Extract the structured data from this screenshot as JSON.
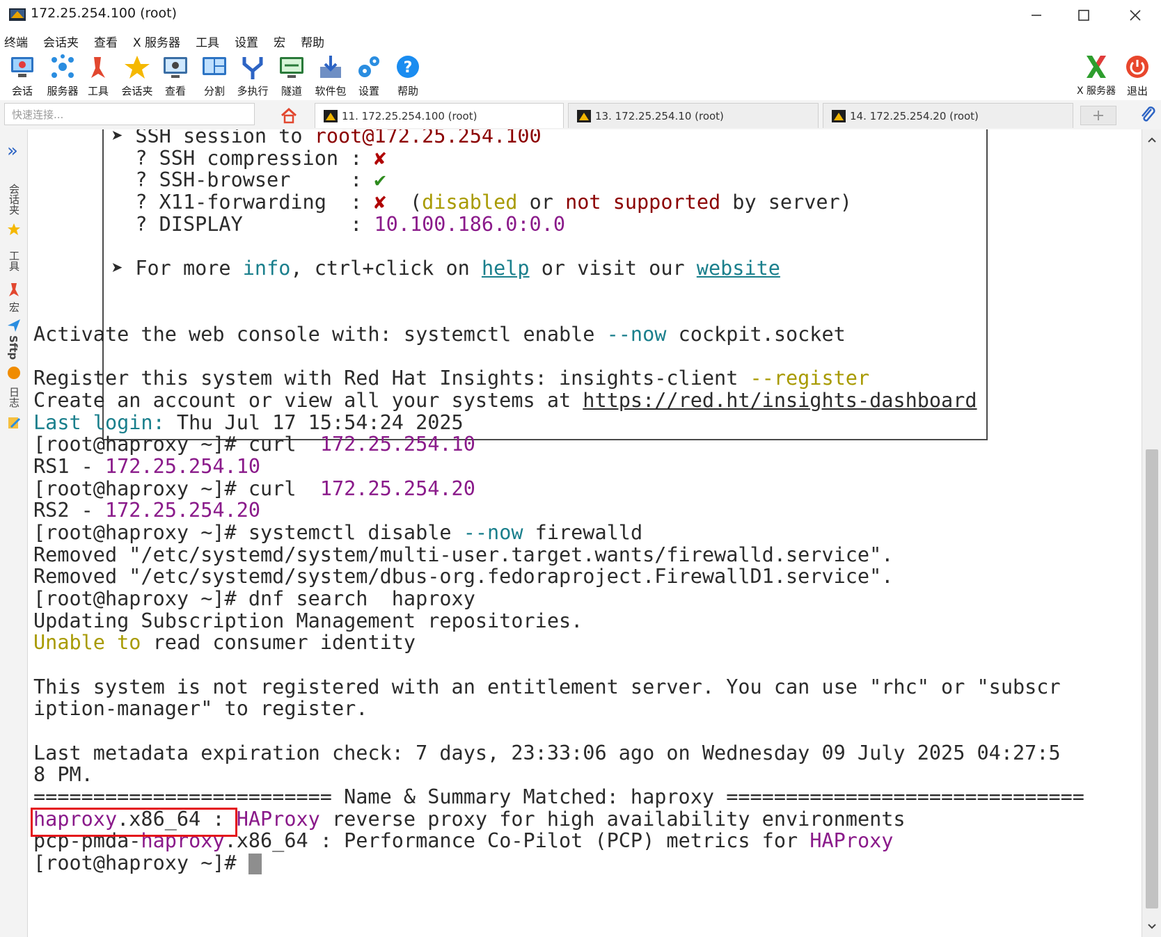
{
  "window": {
    "title": "172.25.254.100 (root)",
    "minimize": "—",
    "maximize": "☐",
    "close": "✕"
  },
  "menu": [
    "终端",
    "会话夹",
    "查看",
    "X 服务器",
    "工具",
    "设置",
    "宏",
    "帮助"
  ],
  "toolbar": {
    "items": [
      "会话",
      "服务器",
      "工具",
      "会话夹",
      "查看",
      "分割",
      "多执行",
      "隧道",
      "软件包",
      "设置",
      "帮助"
    ],
    "xserver": "X 服务器",
    "exit": "退出"
  },
  "quick_connect": {
    "placeholder": "快速连接..."
  },
  "tabs": [
    {
      "label": "11. 172.25.254.100 (root)"
    },
    {
      "label": "13. 172.25.254.10 (root)"
    },
    {
      "label": "14. 172.25.254.20 (root)"
    }
  ],
  "sidebar": {
    "expand": "»",
    "sessions": "会话夹",
    "tools": "工具",
    "macros": "宏",
    "sftp": "Sftp",
    "log": "日志"
  },
  "terminal": {
    "box": {
      "l1_a": "➤ SSH session to ",
      "l1_b": "root@172.25.254.100",
      "l2_a": "  ? SSH compression : ",
      "l2_b": "✘",
      "l3_a": "  ? SSH-browser     : ",
      "l3_b": "✔",
      "l4_a": "  ? X11-forwarding  : ",
      "l4_b": "✘",
      "l4_c": "  (",
      "l4_d": "disabled",
      "l4_e": " or ",
      "l4_f": "not supported",
      "l4_g": " by server)",
      "l5_a": "  ? DISPLAY         : ",
      "l5_b": "10.100.186.0:0.0",
      "l6_a": "➤ For more ",
      "l6_b": "info",
      "l6_c": ", ctrl+click on ",
      "l6_d": "help",
      "l6_e": " or visit our ",
      "l6_f": "website"
    },
    "activate_a": "Activate the web console with: systemctl enable ",
    "activate_b": "--now",
    "activate_c": " cockpit.socket",
    "register_a": "Register this system with Red Hat Insights: insights-client ",
    "register_b": "--register",
    "create_a": "Create an account or view all your systems at ",
    "create_b": "https://red.ht/insights-dashboard",
    "lastlogin_a": "Last login:",
    "lastlogin_b": " Thu Jul 17 15:54:24 2025",
    "curl1_a": "[root@haproxy ~]# curl  ",
    "curl1_b": "172.25.254.10",
    "rs1_a": "RS1 - ",
    "rs1_b": "172.25.254.10",
    "curl2_a": "[root@haproxy ~]# curl  ",
    "curl2_b": "172.25.254.20",
    "rs2_a": "RS2 - ",
    "rs2_b": "172.25.254.20",
    "disable_a": "[root@haproxy ~]# systemctl disable ",
    "disable_b": "--now",
    "disable_c": " firewalld",
    "removed1": "Removed \"/etc/systemd/system/multi-user.target.wants/firewalld.service\".",
    "removed2": "Removed \"/etc/systemd/system/dbus-org.fedoraproject.FirewallD1.service\".",
    "dnf": "[root@haproxy ~]# dnf search  haproxy",
    "updating": "Updating Subscription Management repositories.",
    "unable_a": "Unable to",
    "unable_b": " read consumer identity",
    "notreg1": "This system is not registered with an entitlement server. You can use \"rhc\" or \"subscr",
    "notreg2": "iption-manager\" to register.",
    "meta1": "Last metadata expiration check: 7 days, 23:33:06 ago on Wednesday 09 July 2025 04:27:5",
    "meta2": "8 PM.",
    "sep": "========================= Name & Summary Matched: haproxy ==============================",
    "r1_a": "haproxy",
    "r1_b": ".x86_64 : ",
    "r1_c": "HAProxy",
    "r1_d": " reverse proxy for high availability environments",
    "r2_a": "pcp-pmda-",
    "r2_b": "haproxy",
    "r2_c": ".x86_64 : Performance Co-Pilot (PCP) metrics for ",
    "r2_d": "HAProxy",
    "prompt": "[root@haproxy ~]# "
  }
}
